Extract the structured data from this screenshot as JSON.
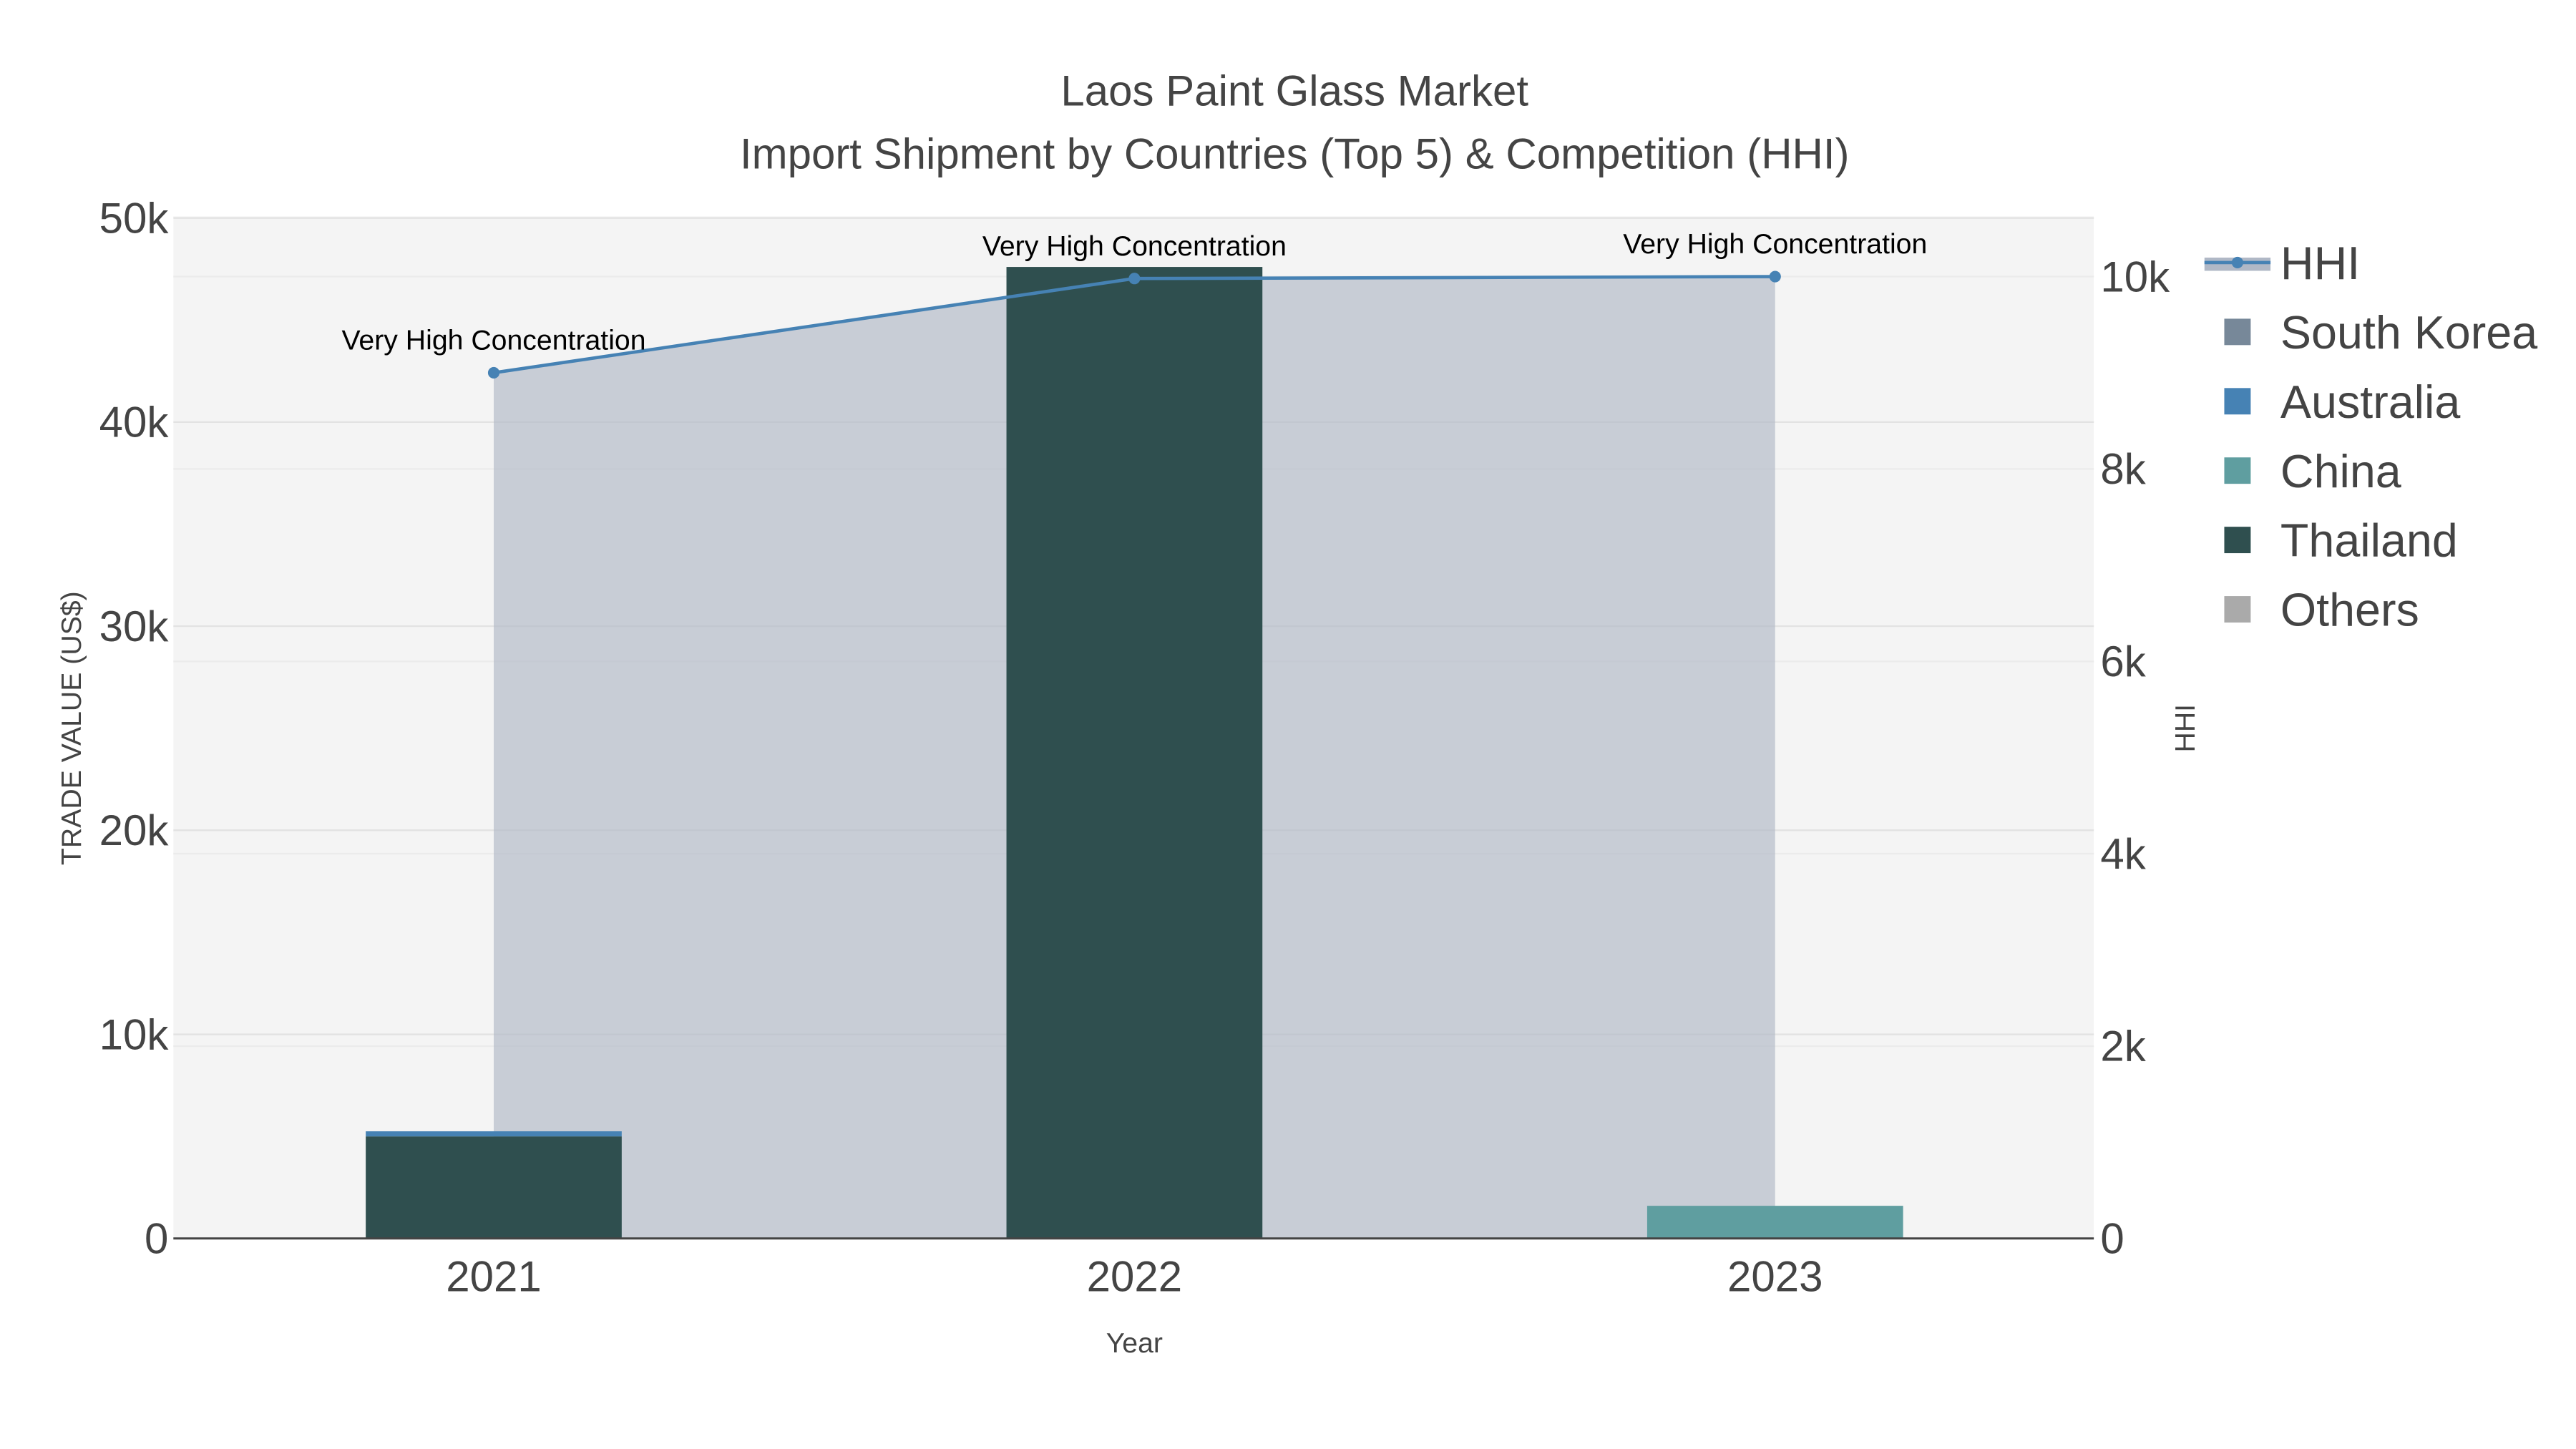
{
  "chart_data": {
    "type": "bar",
    "title": "Laos Paint Glass Market",
    "subtitle": "Import Shipment by Countries (Top 5) & Competition (HHI)",
    "xlabel": "Year",
    "ylabel": "TRADE VALUE (US$)",
    "y2label": "HHI",
    "categories": [
      "2021",
      "2022",
      "2023"
    ],
    "ylim": [
      0,
      50000
    ],
    "y2lim": [
      0,
      10600
    ],
    "yticks": [
      "0",
      "10k",
      "20k",
      "30k",
      "40k",
      "50k"
    ],
    "y2ticks": [
      "0",
      "2k",
      "4k",
      "6k",
      "8k",
      "10k"
    ],
    "barmode": "stack",
    "series": [
      {
        "name": "Thailand",
        "color": "#2f4f4f",
        "values": [
          5000,
          47600,
          0
        ]
      },
      {
        "name": "China",
        "color": "#5f9ea0",
        "values": [
          0,
          0,
          1600
        ]
      },
      {
        "name": "Australia",
        "color": "#4682b4",
        "values": [
          250,
          0,
          0
        ]
      },
      {
        "name": "South Korea",
        "color": "#778899",
        "values": [
          0,
          0,
          0
        ]
      },
      {
        "name": "Others",
        "color": "#aaaaaa",
        "values": [
          0,
          0,
          0
        ]
      }
    ],
    "line": {
      "name": "HHI",
      "color": "#4682b4",
      "fill": "#b0b8c6",
      "values": [
        9000,
        9980,
        10000
      ],
      "annotations": [
        "Very High Concentration",
        "Very High Concentration",
        "Very High Concentration"
      ]
    },
    "legend": [
      "HHI",
      "South Korea",
      "Australia",
      "China",
      "Thailand",
      "Others"
    ],
    "legend_placement": "right",
    "grid": true
  }
}
